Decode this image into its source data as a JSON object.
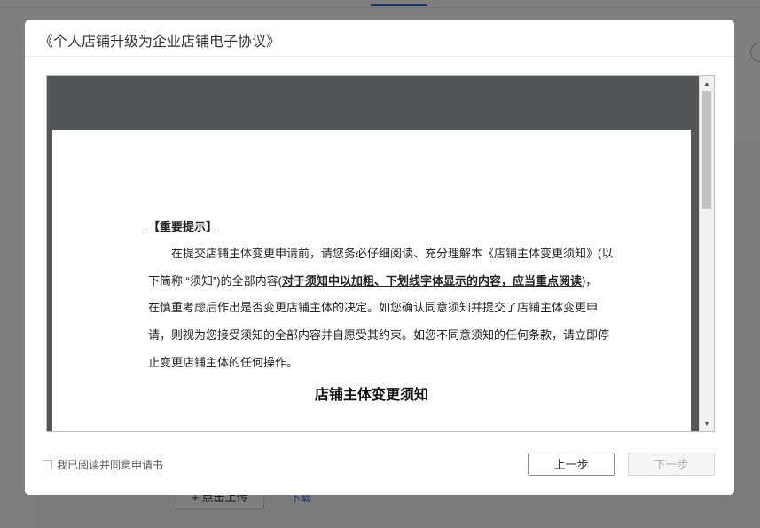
{
  "background": {
    "upload_button": "+ 点击上传",
    "download_link": "下载"
  },
  "modal": {
    "title": "《个人店铺升级为企业店铺电子协议》",
    "document": {
      "important_label": "【重要提示】",
      "para1_line1": "在提交店铺主体变更申请前，请您务必仔细阅读、充分理解本《店铺主体变更须知》(以",
      "para1_line2_a": "下简称 “须知”)的全部内容(",
      "para1_line2_bold": "对于须知中以加粗、下划线字体显示的内容，应当重点阅读",
      "para1_line2_b": ")，",
      "para1_line3": "在慎重考虑后作出是否变更店铺主体的决定。如您确认同意须知并提交了店铺主体变更申",
      "para1_line4": "请，则视为您接受须知的全部内容并自愿受其约束。如您不同意须知的任何条款，请立即停",
      "para1_line5": "止变更店铺主体的任何操作。",
      "heading": "店铺主体变更须知"
    },
    "agree_label": "我已阅读并同意申请书",
    "prev_button": "上一步",
    "next_button": "下一步"
  }
}
